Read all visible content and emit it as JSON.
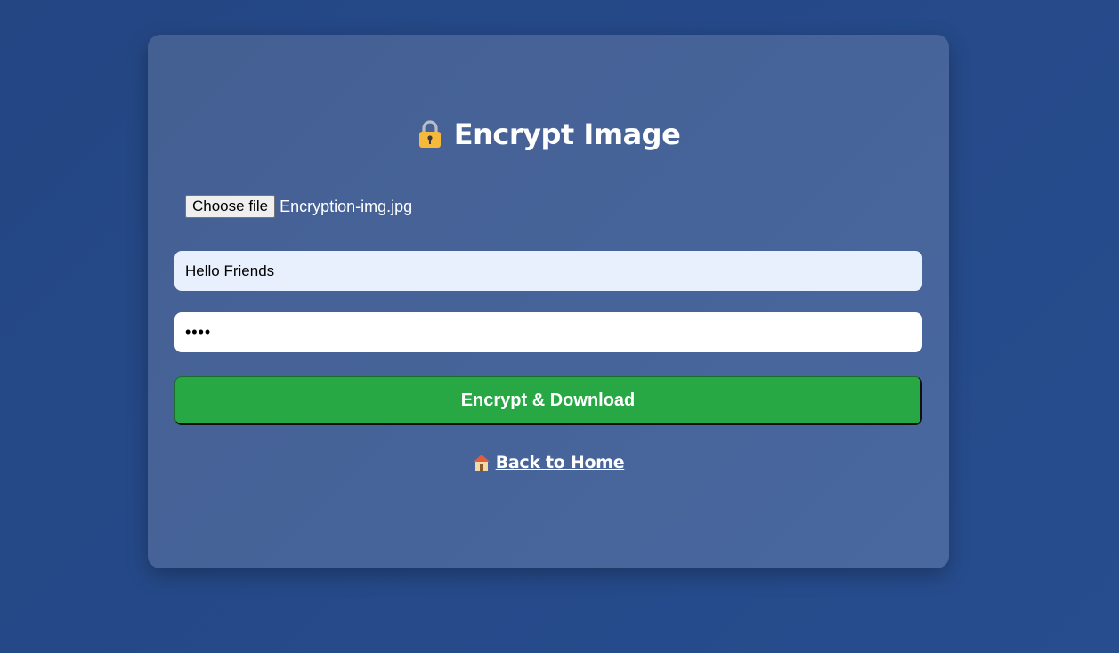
{
  "page": {
    "title": "Encrypt Image",
    "title_icon": "lock-icon"
  },
  "file_input": {
    "button_label": "Choose file",
    "file_name": "Encryption-img.jpg"
  },
  "message_input": {
    "value": "Hello Friends"
  },
  "password_input": {
    "value": "••••"
  },
  "submit": {
    "label": "Encrypt & Download"
  },
  "back_link": {
    "label": "Back to Home",
    "icon": "house-icon"
  },
  "colors": {
    "background": "#244683",
    "card": "#4866a0",
    "button": "#28a745",
    "message_field": "#e8effd"
  }
}
